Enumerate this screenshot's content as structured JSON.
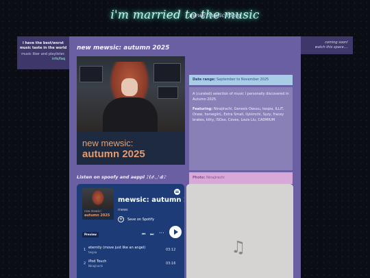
{
  "header": {
    "title": "i'm married to the music",
    "subtitle": "mews' music room"
  },
  "left_box": {
    "line1": "i have the best/worst",
    "line2": "music taste in the world",
    "line3": "music liker and playlister.",
    "link": "info/faq"
  },
  "right_box": {
    "line1": "coming soon!",
    "line2": "watch this space...."
  },
  "post": {
    "title": "new mewsic: autumn 2025",
    "cover_line1": "new mewsic:",
    "cover_line2": "autumn 2025",
    "date_label": "Date range:",
    "date_value": "September to November 2025",
    "description": "A (curated) selection of music I personally discovered in Autumn 2025.",
    "featuring_label": "Featuring:",
    "featuring_value": "Ninajirachi, Genesis Owusu, tespia, ILLIT, Onew, horsegiirL, Extra Small, ilykimchi, Syzy, fracey brakes, kitty, ISOxo, Covex, Louis Liu, CADMIUM",
    "photo_label": "Photo:",
    "photo_value": "Ninajirachi"
  },
  "listen_heading": "Listen on spoofy and aeppl ♪(ง'◡'ง)♪",
  "spotify": {
    "title": "mewsic: autumn 2025",
    "owner": "mews",
    "save_label": "Save on Spotify",
    "preview_label": "Preview",
    "art_line1": "new mewsic:",
    "art_line2": "autumn 2025",
    "tracks": [
      {
        "num": "1",
        "name": "eternity (move just like an angel)",
        "artist": "tespia",
        "duration": "03:12"
      },
      {
        "num": "2",
        "name": "iPod Touch",
        "artist": "Ninajirachi",
        "duration": "03:16"
      }
    ]
  },
  "colors": {
    "main_panel": "#6b5fa3",
    "side_box": "#3d3869",
    "spotify_bg": "#1d3b76",
    "date_bg": "#a8cde6",
    "photo_bg": "#d8a8d8",
    "title_glow": "#5de0c8"
  },
  "icons": {
    "spotify": "spotify-logo-icon",
    "apple_music": "music-note-icon"
  }
}
